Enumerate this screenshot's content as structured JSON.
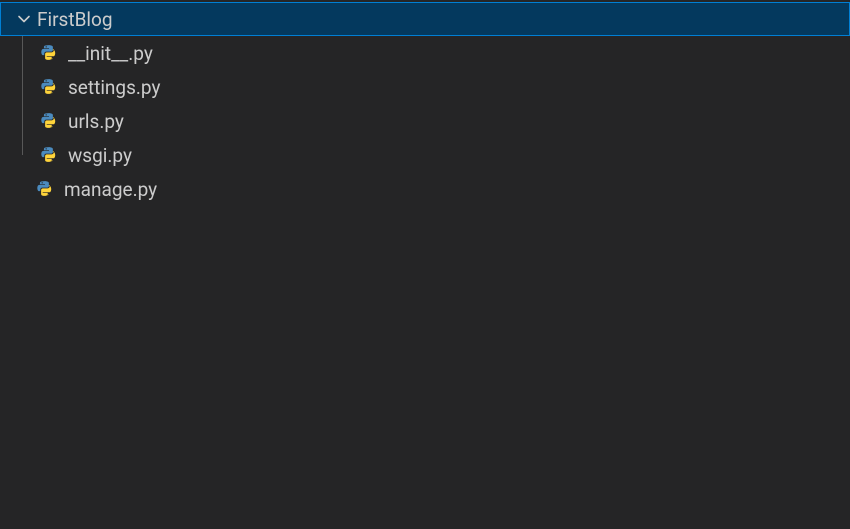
{
  "tree": {
    "folder": {
      "name": "FirstBlog",
      "expanded": true,
      "selected": true
    },
    "children": [
      {
        "name": "__init__.py",
        "type": "python"
      },
      {
        "name": "settings.py",
        "type": "python"
      },
      {
        "name": "urls.py",
        "type": "python"
      },
      {
        "name": "wsgi.py",
        "type": "python"
      }
    ],
    "siblings": [
      {
        "name": "manage.py",
        "type": "python"
      }
    ]
  },
  "colors": {
    "selectedBg": "#04395e",
    "selectedBorder": "#007fd4",
    "panelBg": "#252526",
    "text": "#cccccc"
  }
}
